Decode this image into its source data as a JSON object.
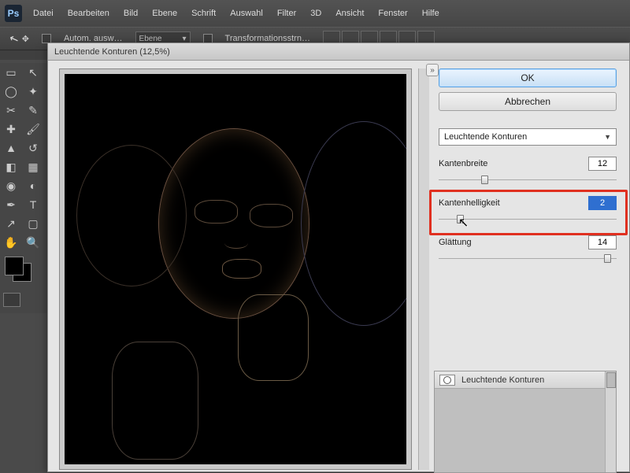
{
  "app": {
    "logo": "Ps"
  },
  "menu": [
    "Datei",
    "Bearbeiten",
    "Bild",
    "Ebene",
    "Schrift",
    "Auswahl",
    "Filter",
    "3D",
    "Ansicht",
    "Fenster",
    "Hilfe"
  ],
  "options": {
    "auto_select_label": "Autom. ausw…",
    "layer_dd": "Ebene",
    "transform_label": "Transformationsstrn…"
  },
  "dialog": {
    "title": "Leuchtende Konturen (12,5%)",
    "ok": "OK",
    "cancel": "Abbrechen",
    "filter_dd": "Leuchtende Konturen",
    "params": {
      "kantenbreite": {
        "label": "Kantenbreite",
        "value": "12",
        "pos": 0.24
      },
      "kantenhelligkeit": {
        "label": "Kantenhelligkeit",
        "value": "2",
        "pos": 0.1
      },
      "glaettung": {
        "label": "Glättung",
        "value": "14",
        "pos": 0.93
      }
    },
    "layers_title": "Leuchtende Konturen"
  }
}
